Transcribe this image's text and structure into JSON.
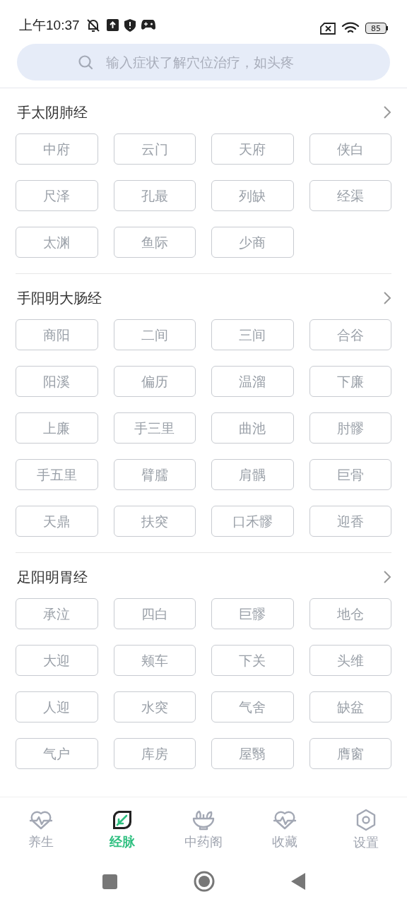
{
  "status_bar": {
    "time": "上午10:37",
    "battery": "85"
  },
  "search": {
    "placeholder": "输入症状了解穴位治疗，如头疼"
  },
  "meridians": [
    {
      "name": "手太阴肺经",
      "points": [
        "中府",
        "云门",
        "天府",
        "侠白",
        "尺泽",
        "孔最",
        "列缺",
        "经渠",
        "太渊",
        "鱼际",
        "少商"
      ]
    },
    {
      "name": "手阳明大肠经",
      "points": [
        "商阳",
        "二间",
        "三间",
        "合谷",
        "阳溪",
        "偏历",
        "温溜",
        "下廉",
        "上廉",
        "手三里",
        "曲池",
        "肘髎",
        "手五里",
        "臂臑",
        "肩髃",
        "巨骨",
        "天鼎",
        "扶突",
        "口禾髎",
        "迎香"
      ]
    },
    {
      "name": "足阳明胃经",
      "points": [
        "承泣",
        "四白",
        "巨髎",
        "地仓",
        "大迎",
        "颊车",
        "下关",
        "头维",
        "人迎",
        "水突",
        "气舍",
        "缺盆",
        "气户",
        "库房",
        "屋翳",
        "膺窗"
      ]
    }
  ],
  "tabs": [
    {
      "label": "养生",
      "kind": "heart",
      "selected": false
    },
    {
      "label": "经脉",
      "kind": "leaf",
      "selected": true
    },
    {
      "label": "中药阁",
      "kind": "bowl",
      "selected": false
    },
    {
      "label": "收藏",
      "kind": "heart",
      "selected": false
    },
    {
      "label": "设置",
      "kind": "gear",
      "selected": false
    }
  ]
}
